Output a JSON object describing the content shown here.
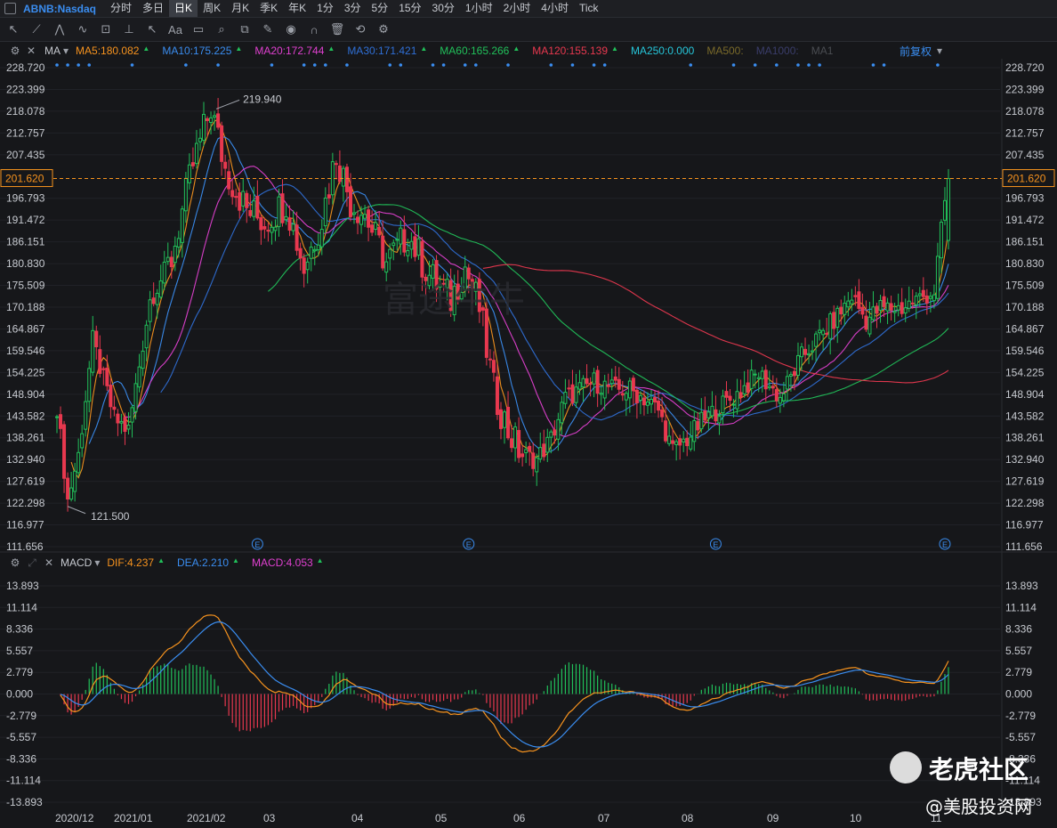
{
  "ticker": "ABNB:Nasdaq",
  "timeframes": [
    "分时",
    "多日",
    "日K",
    "周K",
    "月K",
    "季K",
    "年K",
    "1分",
    "3分",
    "5分",
    "15分",
    "30分",
    "1小时",
    "2小时",
    "4小时",
    "Tick"
  ],
  "active_timeframe": "日K",
  "toolbar_icons": [
    "cursor-icon",
    "line-tool-icon",
    "channel-tool-icon",
    "wave-tool-icon",
    "pattern-tool-icon",
    "fib-tool-icon",
    "arrow-tool-icon",
    "text-tool-icon",
    "note-tool-icon",
    "search-icon",
    "copy-icon",
    "brush-icon",
    "eye-icon",
    "magnet-icon",
    "trash-icon",
    "sync-icon",
    "settings-icon"
  ],
  "ma_legend": {
    "label": "MA",
    "items": [
      {
        "text": "MA5:180.082",
        "color": "#f7931e"
      },
      {
        "text": "MA10:175.225",
        "color": "#3a8df0"
      },
      {
        "text": "MA20:172.744",
        "color": "#e040d0"
      },
      {
        "text": "MA30:171.421",
        "color": "#2f6fd6"
      },
      {
        "text": "MA60:165.266",
        "color": "#21c05a"
      },
      {
        "text": "MA120:155.139",
        "color": "#e8384f"
      },
      {
        "text": "MA250:0.000",
        "color": "#26c6da"
      },
      {
        "text": "MA500:",
        "color": "#7a6a2a"
      },
      {
        "text": "MA1000:",
        "color": "#3a3d6a"
      },
      {
        "text": "MA1",
        "color": "#4a4d52"
      }
    ],
    "adjust": "前复权"
  },
  "macd_legend": {
    "label": "MACD",
    "items": [
      {
        "text": "DIF:4.237",
        "color": "#f7931e"
      },
      {
        "text": "DEA:2.210",
        "color": "#3a8df0"
      },
      {
        "text": "MACD:4.053",
        "color": "#e040d0"
      }
    ]
  },
  "price_axis": [
    "228.720",
    "223.399",
    "218.078",
    "212.757",
    "207.435",
    "201.620",
    "196.793",
    "191.472",
    "186.151",
    "180.830",
    "175.509",
    "170.188",
    "164.867",
    "159.546",
    "154.225",
    "148.904",
    "143.582",
    "138.261",
    "132.940",
    "127.619",
    "122.298",
    "116.977",
    "111.656"
  ],
  "current_price": "201.620",
  "annotations": {
    "high": "219.940",
    "low": "121.500"
  },
  "macd_axis": [
    "13.893",
    "11.114",
    "8.336",
    "5.557",
    "2.779",
    "0.000",
    "-2.779",
    "-5.557",
    "-8.336",
    "-11.114",
    "-13.893"
  ],
  "x_labels": [
    "2020/12",
    "2021/01",
    "2021/02",
    "03",
    "04",
    "05",
    "06",
    "07",
    "08",
    "09",
    "10",
    "11"
  ],
  "earnings_marker": "E",
  "watermark": {
    "center": "富途牛牛",
    "brand": "老虎社区",
    "handle": "@美股投资网"
  },
  "colors": {
    "up": "#21c05a",
    "down": "#e8384f",
    "bg": "#16171a",
    "grid": "#24262b"
  },
  "chart_data": {
    "type": "candlestick",
    "ylim": [
      111.656,
      228.72
    ],
    "macd_ylim": [
      -13.893,
      13.893
    ],
    "months": [
      "2020/12",
      "2021/01",
      "2021/02",
      "03",
      "04",
      "05",
      "06",
      "07",
      "08",
      "09",
      "10",
      "11"
    ],
    "close_anchors": [
      [
        0,
        146
      ],
      [
        3,
        123
      ],
      [
        6,
        134
      ],
      [
        10,
        162
      ],
      [
        16,
        143
      ],
      [
        20,
        140
      ],
      [
        26,
        172
      ],
      [
        32,
        182
      ],
      [
        38,
        205
      ],
      [
        43,
        219
      ],
      [
        47,
        204
      ],
      [
        53,
        194
      ],
      [
        58,
        191
      ],
      [
        64,
        196
      ],
      [
        69,
        180
      ],
      [
        74,
        192
      ],
      [
        78,
        208
      ],
      [
        82,
        196
      ],
      [
        86,
        193
      ],
      [
        92,
        181
      ],
      [
        98,
        188
      ],
      [
        104,
        178
      ],
      [
        110,
        172
      ],
      [
        114,
        180
      ],
      [
        118,
        170
      ],
      [
        122,
        150
      ],
      [
        126,
        140
      ],
      [
        130,
        134
      ],
      [
        134,
        133
      ],
      [
        138,
        138
      ],
      [
        142,
        148
      ],
      [
        146,
        150
      ],
      [
        150,
        152
      ],
      [
        156,
        150
      ],
      [
        160,
        150
      ],
      [
        164,
        148
      ],
      [
        168,
        145
      ],
      [
        172,
        135
      ],
      [
        176,
        138
      ],
      [
        180,
        142
      ],
      [
        184,
        145
      ],
      [
        190,
        149
      ],
      [
        196,
        154
      ],
      [
        202,
        148
      ],
      [
        208,
        158
      ],
      [
        212,
        162
      ],
      [
        218,
        168
      ],
      [
        222,
        173
      ],
      [
        226,
        167
      ],
      [
        230,
        170
      ],
      [
        236,
        170
      ],
      [
        240,
        172
      ],
      [
        245,
        174
      ],
      [
        248,
        196
      ],
      [
        249,
        201.62
      ]
    ],
    "ma_lines": [
      {
        "name": "MA5",
        "color": "#f7931e",
        "period": 5
      },
      {
        "name": "MA10",
        "color": "#3a8df0",
        "period": 10
      },
      {
        "name": "MA20",
        "color": "#e040d0",
        "period": 20
      },
      {
        "name": "MA30",
        "color": "#2f6fd6",
        "period": 30
      },
      {
        "name": "MA60",
        "color": "#21c05a",
        "period": 60
      },
      {
        "name": "MA120",
        "color": "#e8384f",
        "period": 120
      }
    ],
    "last": {
      "DIF": 4.237,
      "DEA": 2.21,
      "MACD": 4.053
    }
  }
}
